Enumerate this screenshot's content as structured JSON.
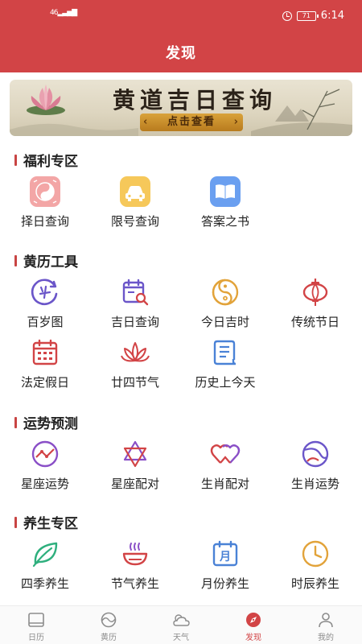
{
  "status_bar": {
    "signal": "46",
    "battery": "71",
    "time": "6:14"
  },
  "header": {
    "title": "发现"
  },
  "banner": {
    "title": "黄道吉日查询",
    "button_label": "点击查看"
  },
  "sections": [
    {
      "title": "福利专区",
      "items": [
        {
          "label": "择日查询",
          "icon": "bagua-icon"
        },
        {
          "label": "限号查询",
          "icon": "car-icon"
        },
        {
          "label": "答案之书",
          "icon": "book-icon"
        }
      ]
    },
    {
      "title": "黄历工具",
      "items": [
        {
          "label": "百岁图",
          "icon": "age-circle-icon"
        },
        {
          "label": "吉日查询",
          "icon": "calendar-search-icon"
        },
        {
          "label": "今日吉时",
          "icon": "yinyang-icon"
        },
        {
          "label": "传统节日",
          "icon": "lantern-icon"
        },
        {
          "label": "法定假日",
          "icon": "calendar-icon"
        },
        {
          "label": "廿四节气",
          "icon": "lotus-icon"
        },
        {
          "label": "历史上今天",
          "icon": "scroll-icon"
        }
      ]
    },
    {
      "title": "运势预测",
      "items": [
        {
          "label": "星座运势",
          "icon": "zodiac-chart-icon"
        },
        {
          "label": "星座配对",
          "icon": "star-of-david-icon"
        },
        {
          "label": "生肖配对",
          "icon": "heart-pair-icon"
        },
        {
          "label": "生肖运势",
          "icon": "orbit-icon"
        }
      ]
    },
    {
      "title": "养生专区",
      "items": [
        {
          "label": "四季养生",
          "icon": "leaf-icon"
        },
        {
          "label": "节气养生",
          "icon": "bowl-icon"
        },
        {
          "label": "月份养生",
          "icon": "month-calendar-icon",
          "glyph": "月"
        },
        {
          "label": "时辰养生",
          "icon": "clock-icon"
        }
      ]
    }
  ],
  "tab_bar": [
    {
      "label": "日历",
      "icon": "calendar-tab-icon",
      "active": false
    },
    {
      "label": "黄历",
      "icon": "yinyang-tab-icon",
      "active": false
    },
    {
      "label": "天气",
      "icon": "weather-tab-icon",
      "active": false
    },
    {
      "label": "发现",
      "icon": "compass-tab-icon",
      "active": true
    },
    {
      "label": "我的",
      "icon": "person-tab-icon",
      "active": false
    }
  ],
  "colors": {
    "header": "#d24446",
    "section_bar": "#c84443",
    "active_tab": "#d24446",
    "inactive_tab": "#8c8c8c"
  }
}
